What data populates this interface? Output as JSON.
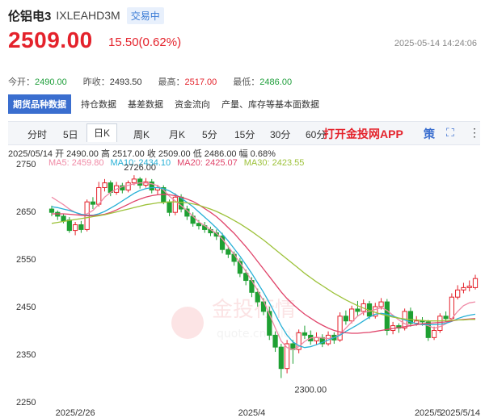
{
  "header": {
    "title": "伦铝电3",
    "code": "IXLEAHD3M",
    "status": "交易中",
    "price": "2509.00",
    "change": "15.50(0.62%)",
    "datetime": "2025-05-14 14:24:06"
  },
  "stats": [
    {
      "label": "今开：",
      "value": "2490.00",
      "tone": "g"
    },
    {
      "label": "昨收：",
      "value": "2493.50",
      "tone": "n"
    },
    {
      "label": "最高：",
      "value": "2517.00",
      "tone": "r"
    },
    {
      "label": "最低：",
      "value": "2486.00",
      "tone": "g"
    }
  ],
  "info_tabs": [
    "期货品种数据",
    "持仓数据",
    "基差数据",
    "资金流向",
    "产量、库存等基本面数据"
  ],
  "period_tabs": [
    "分时",
    "5日",
    "日K",
    "周K",
    "月K",
    "5分",
    "15分",
    "30分",
    "60分"
  ],
  "active_period": "日K",
  "app_link": "打开金投网APP",
  "toolbar_icons": [
    {
      "name": "strategy-icon",
      "glyph": "策"
    },
    {
      "name": "fullscreen-icon",
      "glyph": "⛶"
    },
    {
      "name": "more-icon",
      "glyph": "⋮"
    }
  ],
  "ohlc_line": "2025/05/14  开 2490.00  高 2517.00  收 2509.00  低 2486.00  幅 0.68%",
  "ma_legend": [
    {
      "label": "MA5: 2459.80",
      "color": "#f08aa6"
    },
    {
      "label": "MA10: 2434.10",
      "color": "#27b0d6"
    },
    {
      "label": "MA20: 2425.07",
      "color": "#e0446a"
    },
    {
      "label": "MA30: 2423.55",
      "color": "#9dc23a"
    }
  ],
  "watermark": {
    "cn": "金投行情",
    "en": "quote.cngold.org"
  },
  "colors": {
    "up": "#e4222b",
    "down": "#1ea032",
    "accent": "#3a6ecf"
  },
  "chart_data": {
    "type": "candlestick",
    "ylim": [
      2250,
      2770
    ],
    "yticks": [
      2250,
      2350,
      2450,
      2550,
      2650,
      2750
    ],
    "xtick_labels": [
      {
        "label": "2025/2/26",
        "index": 4
      },
      {
        "label": "2025/4",
        "index": 34
      },
      {
        "label": "2025/5",
        "index": 64
      },
      {
        "label": "2025/5/14",
        "index": 72
      }
    ],
    "annotations": [
      {
        "label": "2726.00",
        "index": 15,
        "value": 2726
      },
      {
        "label": "2300.00",
        "index": 44,
        "value": 2300
      }
    ],
    "candles": [
      [
        2655,
        2648,
        2662,
        2640
      ],
      [
        2648,
        2640,
        2652,
        2632
      ],
      [
        2640,
        2630,
        2645,
        2625
      ],
      [
        2632,
        2610,
        2638,
        2605
      ],
      [
        2610,
        2622,
        2628,
        2600
      ],
      [
        2622,
        2612,
        2630,
        2605
      ],
      [
        2612,
        2670,
        2675,
        2608
      ],
      [
        2670,
        2665,
        2680,
        2655
      ],
      [
        2665,
        2700,
        2712,
        2660
      ],
      [
        2700,
        2710,
        2718,
        2692
      ],
      [
        2710,
        2690,
        2715,
        2682
      ],
      [
        2690,
        2704,
        2712,
        2685
      ],
      [
        2704,
        2695,
        2710,
        2688
      ],
      [
        2695,
        2710,
        2715,
        2690
      ],
      [
        2710,
        2718,
        2726,
        2705
      ],
      [
        2718,
        2705,
        2722,
        2698
      ],
      [
        2705,
        2712,
        2720,
        2700
      ],
      [
        2712,
        2695,
        2718,
        2688
      ],
      [
        2695,
        2700,
        2706,
        2685
      ],
      [
        2700,
        2670,
        2705,
        2665
      ],
      [
        2670,
        2648,
        2675,
        2640
      ],
      [
        2648,
        2680,
        2688,
        2642
      ],
      [
        2680,
        2655,
        2686,
        2648
      ],
      [
        2655,
        2640,
        2662,
        2632
      ],
      [
        2640,
        2625,
        2648,
        2618
      ],
      [
        2625,
        2620,
        2632,
        2612
      ],
      [
        2620,
        2612,
        2628,
        2605
      ],
      [
        2612,
        2605,
        2618,
        2598
      ],
      [
        2605,
        2598,
        2612,
        2590
      ],
      [
        2598,
        2570,
        2605,
        2562
      ],
      [
        2570,
        2560,
        2578,
        2552
      ],
      [
        2560,
        2545,
        2566,
        2536
      ],
      [
        2545,
        2520,
        2552,
        2512
      ],
      [
        2520,
        2505,
        2528,
        2495
      ],
      [
        2505,
        2480,
        2512,
        2470
      ],
      [
        2480,
        2460,
        2488,
        2450
      ],
      [
        2460,
        2440,
        2468,
        2432
      ],
      [
        2440,
        2390,
        2450,
        2380
      ],
      [
        2390,
        2365,
        2398,
        2355
      ],
      [
        2365,
        2320,
        2372,
        2300
      ],
      [
        2320,
        2372,
        2380,
        2310
      ],
      [
        2372,
        2360,
        2380,
        2330
      ],
      [
        2360,
        2395,
        2402,
        2352
      ],
      [
        2395,
        2390,
        2410,
        2382
      ],
      [
        2390,
        2378,
        2400,
        2370
      ],
      [
        2378,
        2385,
        2396,
        2370
      ],
      [
        2385,
        2372,
        2392,
        2365
      ],
      [
        2372,
        2390,
        2398,
        2368
      ],
      [
        2390,
        2380,
        2396,
        2372
      ],
      [
        2380,
        2430,
        2438,
        2376
      ],
      [
        2430,
        2420,
        2442,
        2412
      ],
      [
        2420,
        2445,
        2452,
        2415
      ],
      [
        2445,
        2440,
        2462,
        2430
      ],
      [
        2440,
        2456,
        2465,
        2432
      ],
      [
        2456,
        2430,
        2462,
        2424
      ],
      [
        2430,
        2450,
        2458,
        2425
      ],
      [
        2450,
        2460,
        2468,
        2444
      ],
      [
        2460,
        2400,
        2466,
        2390
      ],
      [
        2400,
        2410,
        2418,
        2392
      ],
      [
        2410,
        2405,
        2415,
        2395
      ],
      [
        2405,
        2440,
        2446,
        2400
      ],
      [
        2440,
        2415,
        2448,
        2408
      ],
      [
        2415,
        2420,
        2430,
        2410
      ],
      [
        2420,
        2418,
        2428,
        2410
      ],
      [
        2418,
        2385,
        2422,
        2378
      ],
      [
        2385,
        2400,
        2408,
        2380
      ],
      [
        2400,
        2430,
        2436,
        2395
      ],
      [
        2430,
        2425,
        2440,
        2418
      ],
      [
        2425,
        2470,
        2478,
        2420
      ],
      [
        2470,
        2485,
        2495,
        2465
      ],
      [
        2485,
        2490,
        2500,
        2478
      ],
      [
        2490,
        2493,
        2505,
        2482
      ],
      [
        2490,
        2509,
        2517,
        2486
      ]
    ],
    "ma": {
      "MA5": [
        2680,
        2672,
        2664,
        2655,
        2648,
        2642,
        2645,
        2652,
        2665,
        2680,
        2690,
        2697,
        2702,
        2705,
        2708,
        2710,
        2710,
        2708,
        2704,
        2695,
        2682,
        2672,
        2662,
        2652,
        2640,
        2628,
        2620,
        2612,
        2604,
        2592,
        2576,
        2560,
        2542,
        2524,
        2505,
        2484,
        2462,
        2434,
        2405,
        2378,
        2364,
        2360,
        2366,
        2377,
        2384,
        2386,
        2384,
        2383,
        2385,
        2392,
        2405,
        2418,
        2430,
        2438,
        2440,
        2444,
        2448,
        2442,
        2432,
        2422,
        2414,
        2410,
        2412,
        2414,
        2410,
        2405,
        2408,
        2414,
        2425,
        2440,
        2452,
        2458,
        2460
      ],
      "MA10": [
        2660,
        2658,
        2655,
        2652,
        2648,
        2644,
        2642,
        2642,
        2645,
        2650,
        2657,
        2664,
        2672,
        2680,
        2688,
        2694,
        2698,
        2700,
        2700,
        2698,
        2693,
        2686,
        2678,
        2669,
        2660,
        2649,
        2638,
        2627,
        2615,
        2602,
        2588,
        2572,
        2556,
        2538,
        2520,
        2500,
        2480,
        2458,
        2434,
        2410,
        2390,
        2376,
        2368,
        2364,
        2366,
        2370,
        2375,
        2380,
        2385,
        2390,
        2398,
        2405,
        2412,
        2420,
        2428,
        2434,
        2436,
        2434,
        2430,
        2426,
        2422,
        2418,
        2414,
        2412,
        2412,
        2412,
        2413,
        2415,
        2419,
        2425,
        2429,
        2432,
        2434
      ],
      "MA20": [
        2645,
        2645,
        2645,
        2644,
        2643,
        2642,
        2641,
        2641,
        2642,
        2644,
        2648,
        2653,
        2659,
        2665,
        2671,
        2676,
        2680,
        2683,
        2685,
        2686,
        2685,
        2683,
        2680,
        2676,
        2671,
        2664,
        2656,
        2648,
        2639,
        2628,
        2616,
        2604,
        2590,
        2576,
        2561,
        2545,
        2529,
        2513,
        2497,
        2481,
        2467,
        2455,
        2444,
        2434,
        2426,
        2418,
        2411,
        2405,
        2400,
        2397,
        2395,
        2394,
        2394,
        2395,
        2396,
        2398,
        2400,
        2402,
        2404,
        2406,
        2408,
        2410,
        2412,
        2414,
        2415,
        2416,
        2417,
        2418,
        2420,
        2422,
        2423,
        2424,
        2425
      ],
      "MA30": [
        2625,
        2627,
        2629,
        2631,
        2633,
        2635,
        2637,
        2639,
        2641,
        2643,
        2646,
        2649,
        2652,
        2655,
        2658,
        2661,
        2664,
        2666,
        2668,
        2669,
        2670,
        2670,
        2669,
        2668,
        2666,
        2663,
        2659,
        2655,
        2650,
        2644,
        2638,
        2631,
        2624,
        2616,
        2608,
        2599,
        2590,
        2580,
        2570,
        2560,
        2550,
        2540,
        2530,
        2520,
        2511,
        2502,
        2494,
        2486,
        2478,
        2471,
        2464,
        2458,
        2452,
        2447,
        2442,
        2438,
        2434,
        2431,
        2428,
        2426,
        2424,
        2423,
        2422,
        2421,
        2420,
        2420,
        2420,
        2421,
        2421,
        2422,
        2422,
        2423,
        2423
      ]
    }
  }
}
